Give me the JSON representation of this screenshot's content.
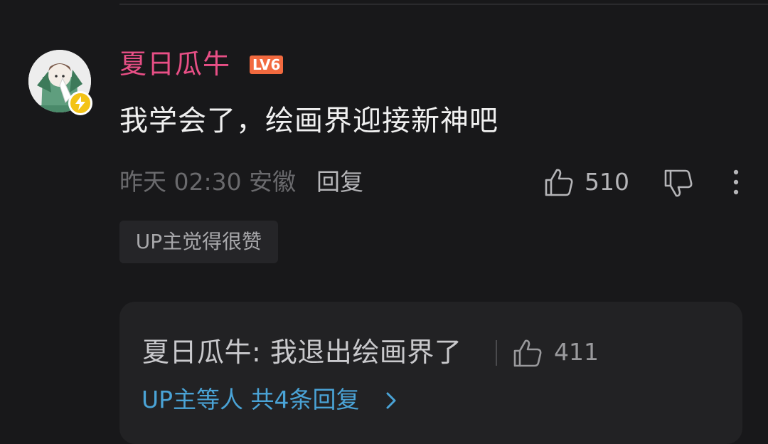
{
  "comment": {
    "username": "夏日瓜牛",
    "level": "LV6",
    "text": "我学会了，绘画界迎接新神吧",
    "meta": "昨天 02:30 安徽",
    "reply_label": "回复",
    "like_count": "510",
    "up_tag": "UP主觉得很赞",
    "icons": {
      "like": "thumbs-up-icon",
      "dislike": "thumbs-down-icon",
      "more": "more-vertical-icon",
      "badge": "lightning-icon"
    }
  },
  "reply_preview": {
    "text": "夏日瓜牛: 我退出绘画界了",
    "like_count": "411",
    "more_label": "UP主等人 共4条回复"
  },
  "colors": {
    "background": "#18181a",
    "username": "#e84f86",
    "level_badge": "#f26a3f",
    "link": "#4aa3d6",
    "avatar_badge": "#f3c316"
  }
}
